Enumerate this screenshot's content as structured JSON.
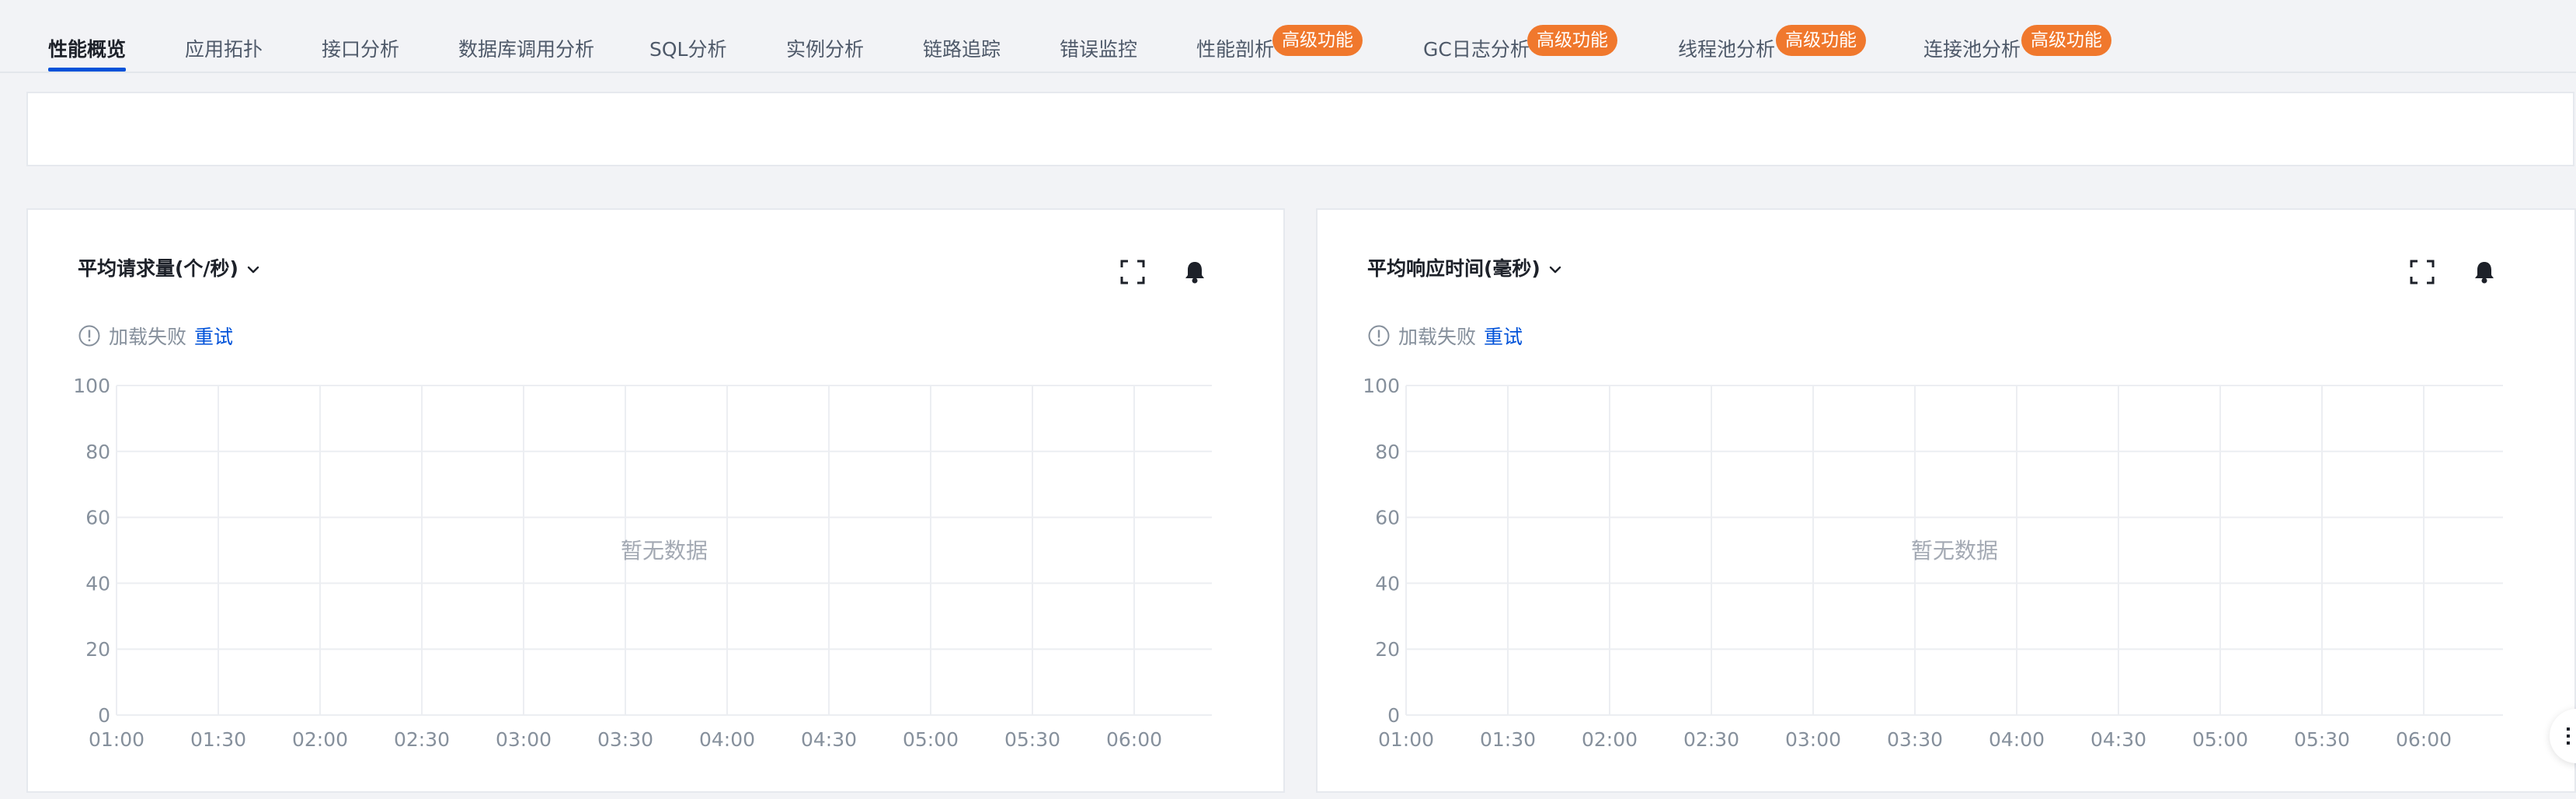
{
  "tabs": [
    {
      "label": "性能概览",
      "active": true
    },
    {
      "label": "应用拓扑"
    },
    {
      "label": "接口分析"
    },
    {
      "label": "数据库调用分析"
    },
    {
      "label": "SQL分析"
    },
    {
      "label": "实例分析"
    },
    {
      "label": "链路追踪"
    },
    {
      "label": "错误监控"
    },
    {
      "label": "性能剖析",
      "badge": "高级功能"
    },
    {
      "label": "GC日志分析",
      "badge": "高级功能"
    },
    {
      "label": "线程池分析",
      "badge": "高级功能"
    },
    {
      "label": "连接池分析",
      "badge": "高级功能"
    }
  ],
  "cards": [
    {
      "title": "平均请求量(个/秒)",
      "error_text": "加载失败",
      "retry_label": "重试",
      "empty_text": "暂无数据"
    },
    {
      "title": "平均响应时间(毫秒)",
      "error_text": "加载失败",
      "retry_label": "重试",
      "empty_text": "暂无数据"
    }
  ],
  "colors": {
    "accent": "#0052d9",
    "badge": "#f0782d",
    "grid": "#eceef2",
    "muted": "#86909c"
  },
  "icons": {
    "fullscreen": "fullscreen-icon",
    "alarm": "bell-icon",
    "warning": "info-circle-icon",
    "dropdown": "chevron-down-icon"
  },
  "chart_data": [
    {
      "type": "line",
      "title": "平均请求量(个/秒)",
      "x": [
        "01:00",
        "01:30",
        "02:00",
        "02:30",
        "03:00",
        "03:30",
        "04:00",
        "04:30",
        "05:00",
        "05:30",
        "06:00"
      ],
      "yticks": [
        0,
        20,
        40,
        60,
        80,
        100
      ],
      "ylim": [
        0,
        100
      ],
      "series": [],
      "grid": true,
      "annotation": "暂无数据"
    },
    {
      "type": "line",
      "title": "平均响应时间(毫秒)",
      "x": [
        "01:00",
        "01:30",
        "02:00",
        "02:30",
        "03:00",
        "03:30",
        "04:00",
        "04:30",
        "05:00",
        "05:30",
        "06:00"
      ],
      "yticks": [
        0,
        20,
        40,
        60,
        80,
        100
      ],
      "ylim": [
        0,
        100
      ],
      "series": [],
      "grid": true,
      "annotation": "暂无数据"
    }
  ]
}
